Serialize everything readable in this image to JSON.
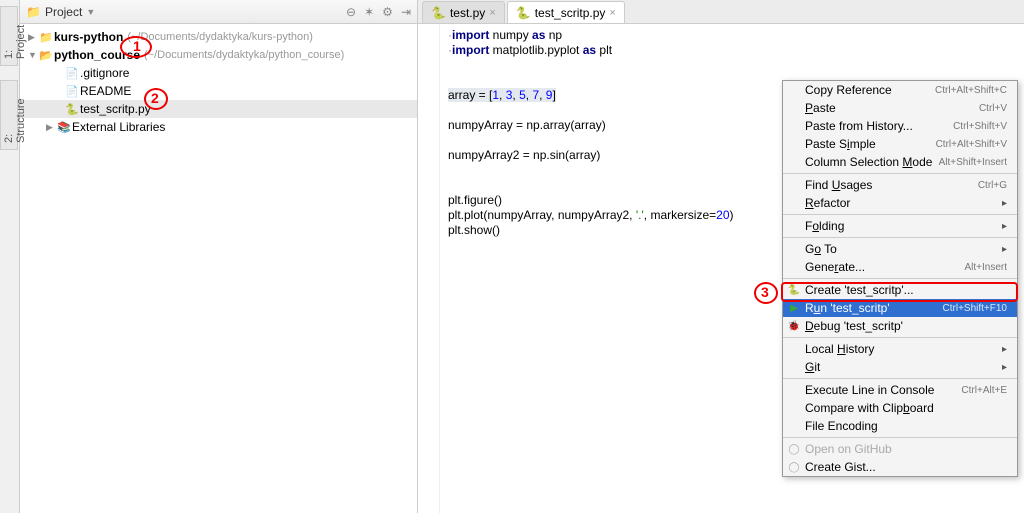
{
  "left_tabs": {
    "project": "1: Project",
    "structure": "2: Structure"
  },
  "panel": {
    "title": "Project",
    "icons": {
      "collapse": "⊖",
      "expand": "✶",
      "settings": "⚙",
      "hide": "⇥"
    }
  },
  "tree": {
    "root1": {
      "label": "kurs-python",
      "path": "(~/Documents/dydaktyka/kurs-python)"
    },
    "root2": {
      "label": "python_course",
      "path": "(~/Documents/dydaktyka/python_course)"
    },
    "gitignore": ".gitignore",
    "readme": "README",
    "test_script": "test_scritp.py",
    "ext_libs": "External Libraries"
  },
  "tabs": {
    "test_py": "test.py",
    "test_script_py": "test_scritp.py"
  },
  "code": {
    "l1a": "import",
    "l1b": " numpy ",
    "l1c": "as",
    "l1d": " np",
    "l2a": "import",
    "l2b": " matplotlib.pyplot ",
    "l2c": "as",
    "l2d": " plt",
    "l4a": "array = ",
    "l4b": "[",
    "l4c": "1",
    "l4d": ", ",
    "l4e": "3",
    "l4f": ", ",
    "l4g": "5",
    "l4h": ", ",
    "l4i": "7",
    "l4j": ", ",
    "l4k": "9",
    "l4l": "]",
    "l6": "numpyArray = np.array(array)",
    "l8": "numpyArray2 = np.sin(array)",
    "l11": "plt.figure()",
    "l12a": "plt.plot(numpyArray, numpyArray2, ",
    "l12b": "'.'",
    "l12c": ", markersize=",
    "l12d": "20",
    "l12e": ")",
    "l13": "plt.show()"
  },
  "menu": {
    "copy_ref": "Copy Reference",
    "copy_ref_sc": "Ctrl+Alt+Shift+C",
    "paste": "Paste",
    "paste_sc": "Ctrl+V",
    "paste_hist": "Paste from History...",
    "paste_hist_sc": "Ctrl+Shift+V",
    "paste_simple": "Paste Simple",
    "paste_simple_sc": "Ctrl+Alt+Shift+V",
    "col_sel": "Column Selection Mode",
    "col_sel_sc": "Alt+Shift+Insert",
    "find_usages": "Find Usages",
    "find_usages_sc": "Ctrl+G",
    "refactor": "Refactor",
    "folding": "Folding",
    "goto": "Go To",
    "generate": "Generate...",
    "generate_sc": "Alt+Insert",
    "create": "Create 'test_scritp'...",
    "run": "Run 'test_scritp'",
    "run_sc": "Ctrl+Shift+F10",
    "debug": "Debug 'test_scritp'",
    "local_hist": "Local History",
    "git": "Git",
    "exec_console": "Execute Line in Console",
    "exec_console_sc": "Ctrl+Alt+E",
    "compare_clip": "Compare with Clipboard",
    "file_enc": "File Encoding",
    "open_github": "Open on GitHub",
    "create_gist": "Create Gist..."
  },
  "ann": {
    "n1": "1",
    "n2": "2",
    "n3": "3"
  }
}
